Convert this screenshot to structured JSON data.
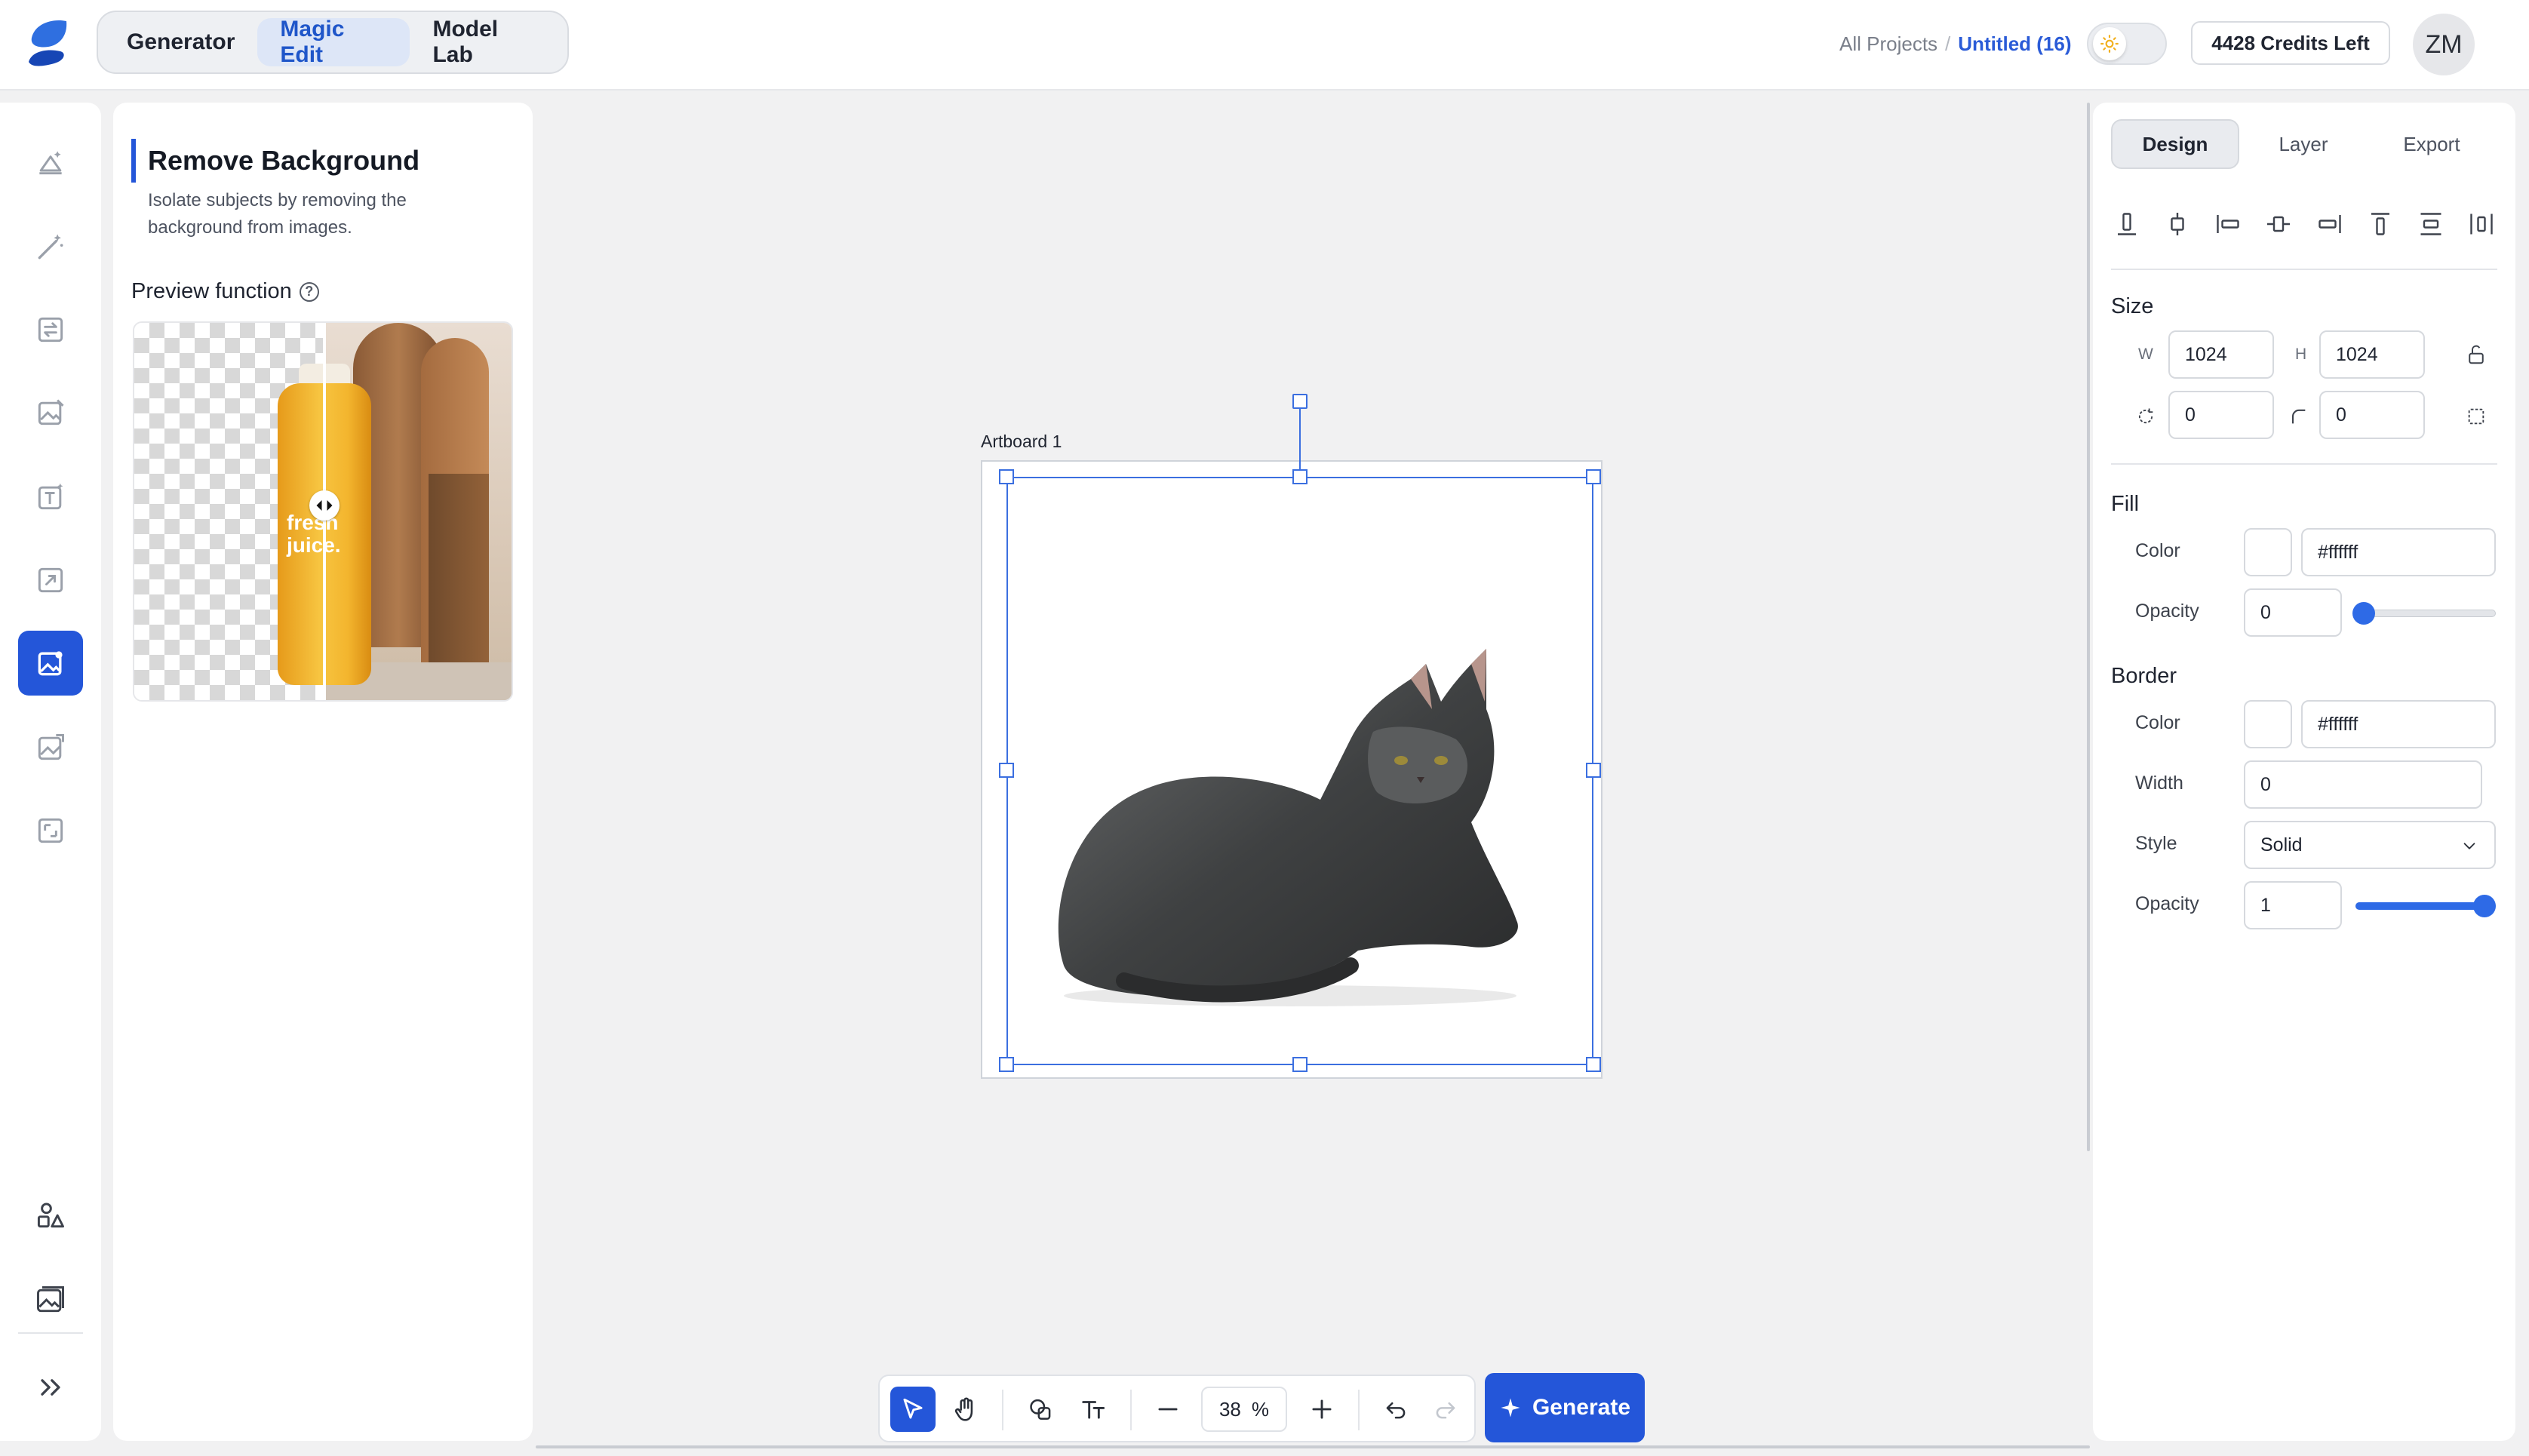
{
  "header": {
    "mode_tabs": [
      {
        "label": "Generator"
      },
      {
        "label": "Magic Edit"
      },
      {
        "label": "Model Lab"
      }
    ],
    "breadcrumb": {
      "root": "All Projects",
      "separator": "/",
      "current": "Untitled (16)"
    },
    "credits": "4428 Credits Left",
    "avatar_initials": "ZM"
  },
  "panel": {
    "title": "Remove Background",
    "description": "Isolate subjects by removing the background from images.",
    "preview_label": "Preview function",
    "help_glyph": "?",
    "preview_image_text": [
      "fresh",
      "juice."
    ]
  },
  "canvas": {
    "artboard_label": "Artboard 1"
  },
  "toolbar": {
    "zoom_value": "38",
    "zoom_unit": "%",
    "generate_label": "Generate"
  },
  "right_panel": {
    "tabs": [
      {
        "label": "Design"
      },
      {
        "label": "Layer"
      },
      {
        "label": "Export"
      }
    ],
    "size": {
      "title": "Size",
      "w_label": "W",
      "w_value": "1024",
      "h_label": "H",
      "h_value": "1024",
      "rotation_value": "0",
      "radius_value": "0"
    },
    "fill": {
      "title": "Fill",
      "color_label": "Color",
      "color_value": "#ffffff",
      "opacity_label": "Opacity",
      "opacity_value": "0"
    },
    "border": {
      "title": "Border",
      "color_label": "Color",
      "color_value": "#ffffff",
      "width_label": "Width",
      "width_value": "0",
      "style_label": "Style",
      "style_value": "Solid",
      "opacity_label": "Opacity",
      "opacity_value": "1"
    }
  },
  "colors": {
    "accent": "#2456d9",
    "selection": "#3b6fe0",
    "canvas_bg": "#f1f1f2"
  }
}
